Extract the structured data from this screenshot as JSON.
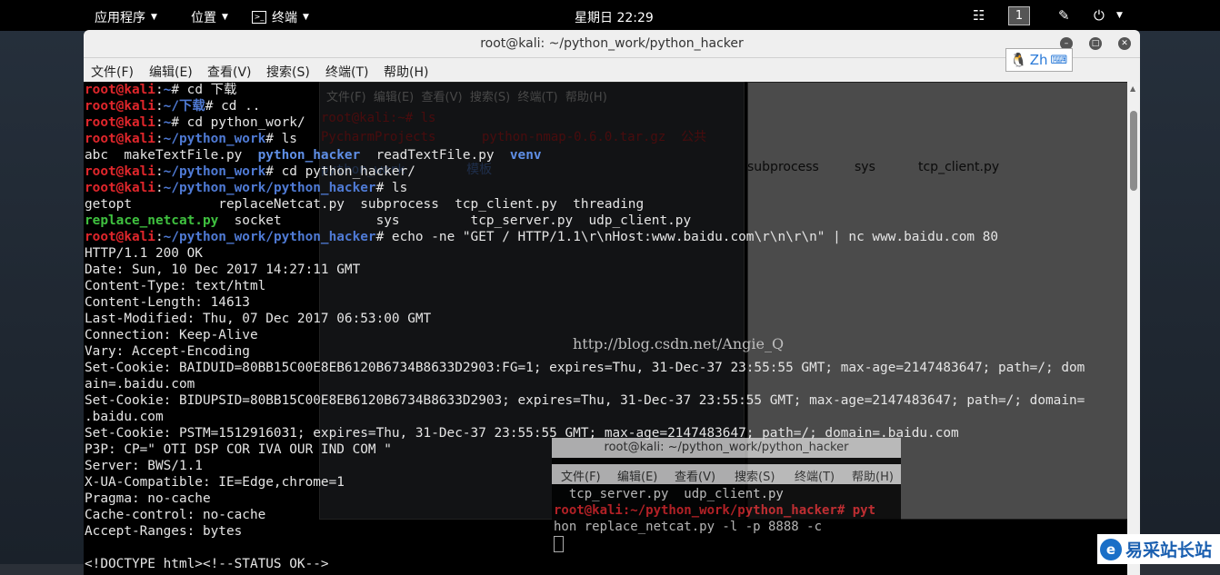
{
  "top_panel": {
    "applications": "应用程序",
    "places": "位置",
    "terminal_menu": "终端",
    "clock": "星期日 22:29",
    "workspace": "1"
  },
  "window": {
    "title": "root@kali: ~/python_work/python_hacker",
    "menu": [
      "文件(F)",
      "编辑(E)",
      "查看(V)",
      "搜索(S)",
      "终端(T)",
      "帮助(H)"
    ]
  },
  "ime": {
    "label": "Zh"
  },
  "terminal": {
    "lines": [
      [
        {
          "c": "u",
          "t": "root@kali"
        },
        {
          "c": "w",
          "t": ":"
        },
        {
          "c": "p",
          "t": "~"
        },
        {
          "c": "w",
          "t": "# cd 下载"
        }
      ],
      [
        {
          "c": "u",
          "t": "root@kali"
        },
        {
          "c": "w",
          "t": ":"
        },
        {
          "c": "p",
          "t": "~/下载"
        },
        {
          "c": "w",
          "t": "# cd .."
        }
      ],
      [
        {
          "c": "u",
          "t": "root@kali"
        },
        {
          "c": "w",
          "t": ":"
        },
        {
          "c": "p",
          "t": "~"
        },
        {
          "c": "w",
          "t": "# cd python_work/"
        }
      ],
      [
        {
          "c": "u",
          "t": "root@kali"
        },
        {
          "c": "w",
          "t": ":"
        },
        {
          "c": "p",
          "t": "~/python_work"
        },
        {
          "c": "w",
          "t": "# ls"
        }
      ],
      [
        {
          "c": "w",
          "t": "abc  makeTextFile.py  "
        },
        {
          "c": "b",
          "t": "python_hacker"
        },
        {
          "c": "w",
          "t": "  readTextFile.py  "
        },
        {
          "c": "b",
          "t": "venv"
        }
      ],
      [
        {
          "c": "u",
          "t": "root@kali"
        },
        {
          "c": "w",
          "t": ":"
        },
        {
          "c": "p",
          "t": "~/python_work"
        },
        {
          "c": "w",
          "t": "# cd python_hacker/"
        }
      ],
      [
        {
          "c": "u",
          "t": "root@kali"
        },
        {
          "c": "w",
          "t": ":"
        },
        {
          "c": "p",
          "t": "~/python_work/python_hacker"
        },
        {
          "c": "w",
          "t": "# ls"
        }
      ],
      [
        {
          "c": "w",
          "t": "getopt           replaceNetcat.py  subprocess  tcp_client.py  threading"
        }
      ],
      [
        {
          "c": "g",
          "t": "replace_netcat.py"
        },
        {
          "c": "w",
          "t": "  socket            sys         tcp_server.py  udp_client.py"
        }
      ],
      [
        {
          "c": "u",
          "t": "root@kali"
        },
        {
          "c": "w",
          "t": ":"
        },
        {
          "c": "p",
          "t": "~/python_work/python_hacker"
        },
        {
          "c": "w",
          "t": "# echo -ne \"GET / HTTP/1.1\\r\\nHost:www.baidu.com\\r\\n\\r\\n\" | nc www.baidu.com 80"
        }
      ],
      [
        {
          "c": "w",
          "t": "HTTP/1.1 200 OK"
        }
      ],
      [
        {
          "c": "w",
          "t": "Date: Sun, 10 Dec 2017 14:27:11 GMT"
        }
      ],
      [
        {
          "c": "w",
          "t": "Content-Type: text/html"
        }
      ],
      [
        {
          "c": "w",
          "t": "Content-Length: 14613"
        }
      ],
      [
        {
          "c": "w",
          "t": "Last-Modified: Thu, 07 Dec 2017 06:53:00 GMT"
        }
      ],
      [
        {
          "c": "w",
          "t": "Connection: Keep-Alive"
        }
      ],
      [
        {
          "c": "w",
          "t": "Vary: Accept-Encoding"
        }
      ],
      [
        {
          "c": "w",
          "t": "Set-Cookie: BAIDUID=80BB15C00E8EB6120B6734B8633D2903:FG=1; expires=Thu, 31-Dec-37 23:55:55 GMT; max-age=2147483647; path=/; dom"
        }
      ],
      [
        {
          "c": "w",
          "t": "ain=.baidu.com"
        }
      ],
      [
        {
          "c": "w",
          "t": "Set-Cookie: BIDUPSID=80BB15C00E8EB6120B6734B8633D2903; expires=Thu, 31-Dec-37 23:55:55 GMT; max-age=2147483647; path=/; domain="
        }
      ],
      [
        {
          "c": "w",
          "t": ".baidu.com"
        }
      ],
      [
        {
          "c": "w",
          "t": "Set-Cookie: PSTM=1512916031; expires=Thu, 31-Dec-37 23:55:55 GMT; max-age=2147483647; path=/; domain=.baidu.com"
        }
      ],
      [
        {
          "c": "w",
          "t": "P3P: CP=\" OTI DSP COR IVA OUR IND COM \""
        }
      ],
      [
        {
          "c": "w",
          "t": "Server: BWS/1.1"
        }
      ],
      [
        {
          "c": "w",
          "t": "X-UA-Compatible: IE=Edge,chrome=1"
        }
      ],
      [
        {
          "c": "w",
          "t": "Pragma: no-cache"
        }
      ],
      [
        {
          "c": "w",
          "t": "Cache-control: no-cache"
        }
      ],
      [
        {
          "c": "w",
          "t": "Accept-Ranges: bytes"
        }
      ],
      [
        {
          "c": "w",
          "t": ""
        }
      ],
      [
        {
          "c": "w",
          "t": "<!DOCTYPE html><!--STATUS OK-->"
        }
      ]
    ]
  },
  "watermark": "http://blog.csdn.net/Angie_Q",
  "background_window": {
    "menu": [
      "文件(F)",
      "编辑(E)",
      "查看(V)",
      "搜索(S)",
      "终端(T)",
      "帮助(H)"
    ],
    "lines": [
      "root@kali:~# ls",
      "PycharmProjects      python-nmap-0.6.0.tar.gz  公共",
      "python_work        模板"
    ],
    "files": [
      "subprocess",
      "sys",
      "tcp_client.py"
    ]
  },
  "mini_window": {
    "title": "root@kali: ~/python_work/python_hacker",
    "menu": [
      "文件(F)",
      "编辑(E)",
      "查看(V)",
      "搜索(S)",
      "终端(T)",
      "帮助(H)"
    ],
    "lines": [
      "  tcp_server.py  udp_client.py",
      "root@kali:~/python_work/python_hacker# pyt",
      "hon replace_netcat.py -l -p 8888 -c"
    ]
  },
  "logo": {
    "text": "易采站长站"
  }
}
